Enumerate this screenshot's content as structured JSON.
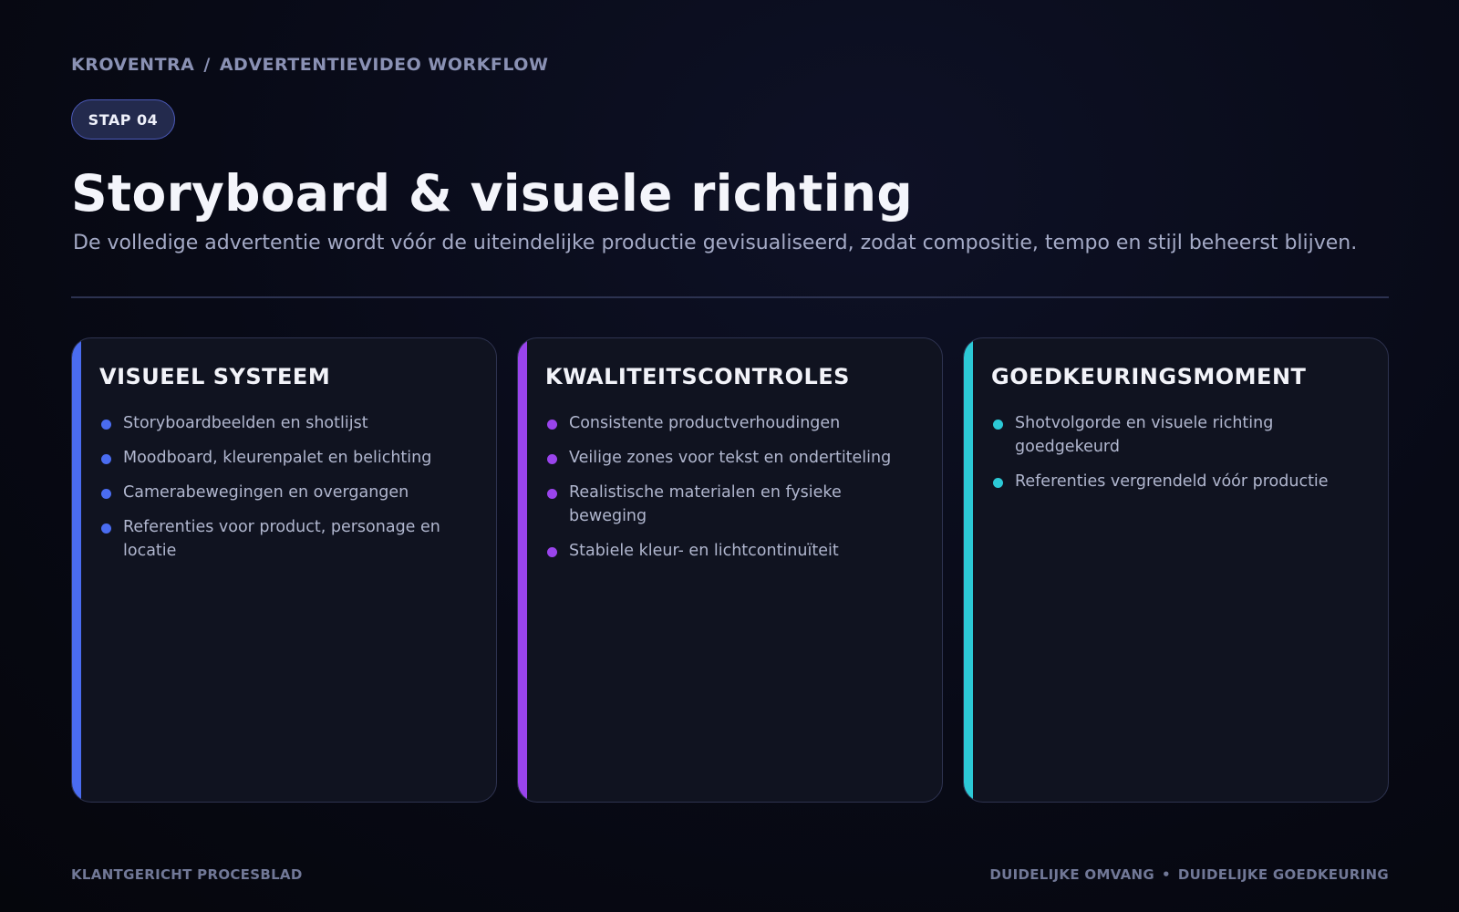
{
  "breadcrumb": {
    "brand": "KROVENTRA",
    "separator": "/",
    "section": "ADVERTENTIEVIDEO WORKFLOW"
  },
  "step_badge": "STAP 04",
  "title": "Storyboard & visuele richting",
  "subtitle": "De volledige advertentie wordt vóór de uiteindelijke productie gevisualiseerd, zodat compositie, tempo en stijl beheerst blijven.",
  "cards": [
    {
      "title": "VISUEEL SYSTEEM",
      "accent_color": "#4a6cf0",
      "items": [
        "Storyboardbeelden en shotlijst",
        "Moodboard, kleurenpalet en belichting",
        "Camerabewegingen en overgangen",
        "Referenties voor product, personage en locatie"
      ]
    },
    {
      "title": "KWALITEITSCONTROLES",
      "accent_color": "#9a44ec",
      "items": [
        "Consistente productverhoudingen",
        "Veilige zones voor tekst en ondertiteling",
        "Realistische materialen en fysieke beweging",
        "Stabiele kleur- en lichtcontinuïteit"
      ]
    },
    {
      "title": "GOEDKEURINGSMOMENT",
      "accent_color": "#2cc9d6",
      "items": [
        "Shotvolgorde en visuele richting goedgekeurd",
        "Referenties vergrendeld vóór productie"
      ]
    }
  ],
  "footer": {
    "left": "KLANTGERICHT PROCESBLAD",
    "right_a": "DUIDELIJKE OMVANG",
    "right_sep": "•",
    "right_b": "DUIDELIJKE GOEDKEURING"
  }
}
